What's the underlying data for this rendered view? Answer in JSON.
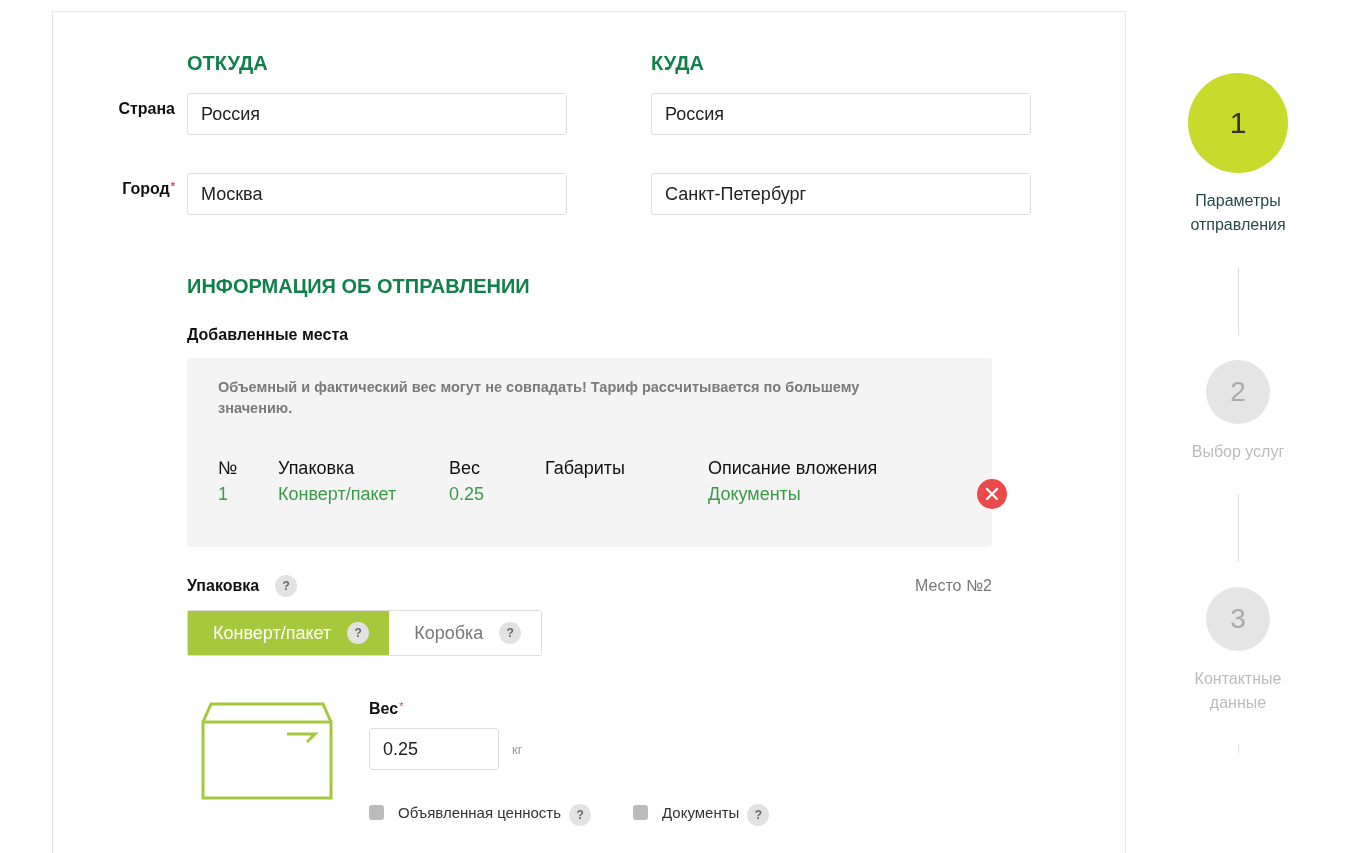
{
  "from": {
    "heading": "ОТКУДА",
    "country": "Россия",
    "city": "Москва"
  },
  "to": {
    "heading": "КУДА",
    "country": "Россия",
    "city": "Санкт-Петербург"
  },
  "labels": {
    "country": "Страна",
    "city": "Город",
    "city_required": "*"
  },
  "shipment": {
    "heading": "ИНФОРМАЦИЯ ОБ ОТПРАВЛЕНИИ",
    "subheading": "Добавленные места",
    "notice": "Объемный и фактический вес могут не совпадать! Тариф рассчитывается по большему значению.",
    "columns": [
      "№",
      "Упаковка",
      "Вес",
      "Габариты",
      "Описание вложения"
    ],
    "rows": [
      {
        "cells": [
          "1",
          "Конверт/пакет",
          "0.25",
          "",
          "Документы"
        ]
      }
    ]
  },
  "packing": {
    "label": "Упаковка",
    "help": "?",
    "place": "Место №2",
    "options": [
      {
        "label": "Конверт/пакет",
        "help": "?",
        "selected": true
      },
      {
        "label": "Коробка",
        "help": "?",
        "selected": false
      }
    ]
  },
  "weight": {
    "label": "Вес",
    "required": "*",
    "value": "0.25",
    "unit": "кг"
  },
  "checkboxes": [
    {
      "label": "Объявленная ценность",
      "help": "?",
      "checked": false
    },
    {
      "label": "Документы",
      "help": "?",
      "checked": false
    }
  ],
  "steps": [
    {
      "number": "1",
      "label": "Параметры отправления",
      "selected": true
    },
    {
      "number": "2",
      "label": "Выбор услуг",
      "selected": false
    },
    {
      "number": "3",
      "label": "Контактные данные",
      "selected": false
    }
  ]
}
